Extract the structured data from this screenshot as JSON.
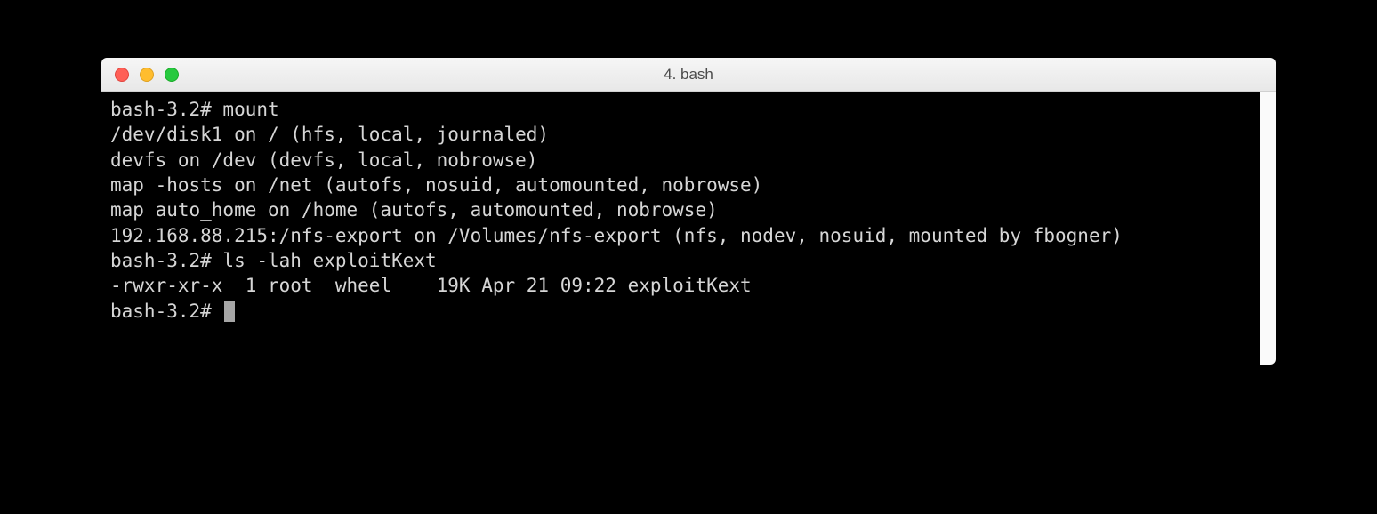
{
  "window": {
    "title": "4. bash"
  },
  "terminal": {
    "lines": [
      "bash-3.2# mount",
      "/dev/disk1 on / (hfs, local, journaled)",
      "devfs on /dev (devfs, local, nobrowse)",
      "map -hosts on /net (autofs, nosuid, automounted, nobrowse)",
      "map auto_home on /home (autofs, automounted, nobrowse)",
      "192.168.88.215:/nfs-export on /Volumes/nfs-export (nfs, nodev, nosuid, mounted by fbogner)",
      "bash-3.2# ls -lah exploitKext",
      "-rwxr-xr-x  1 root  wheel    19K Apr 21 09:22 exploitKext",
      "bash-3.2# "
    ]
  }
}
